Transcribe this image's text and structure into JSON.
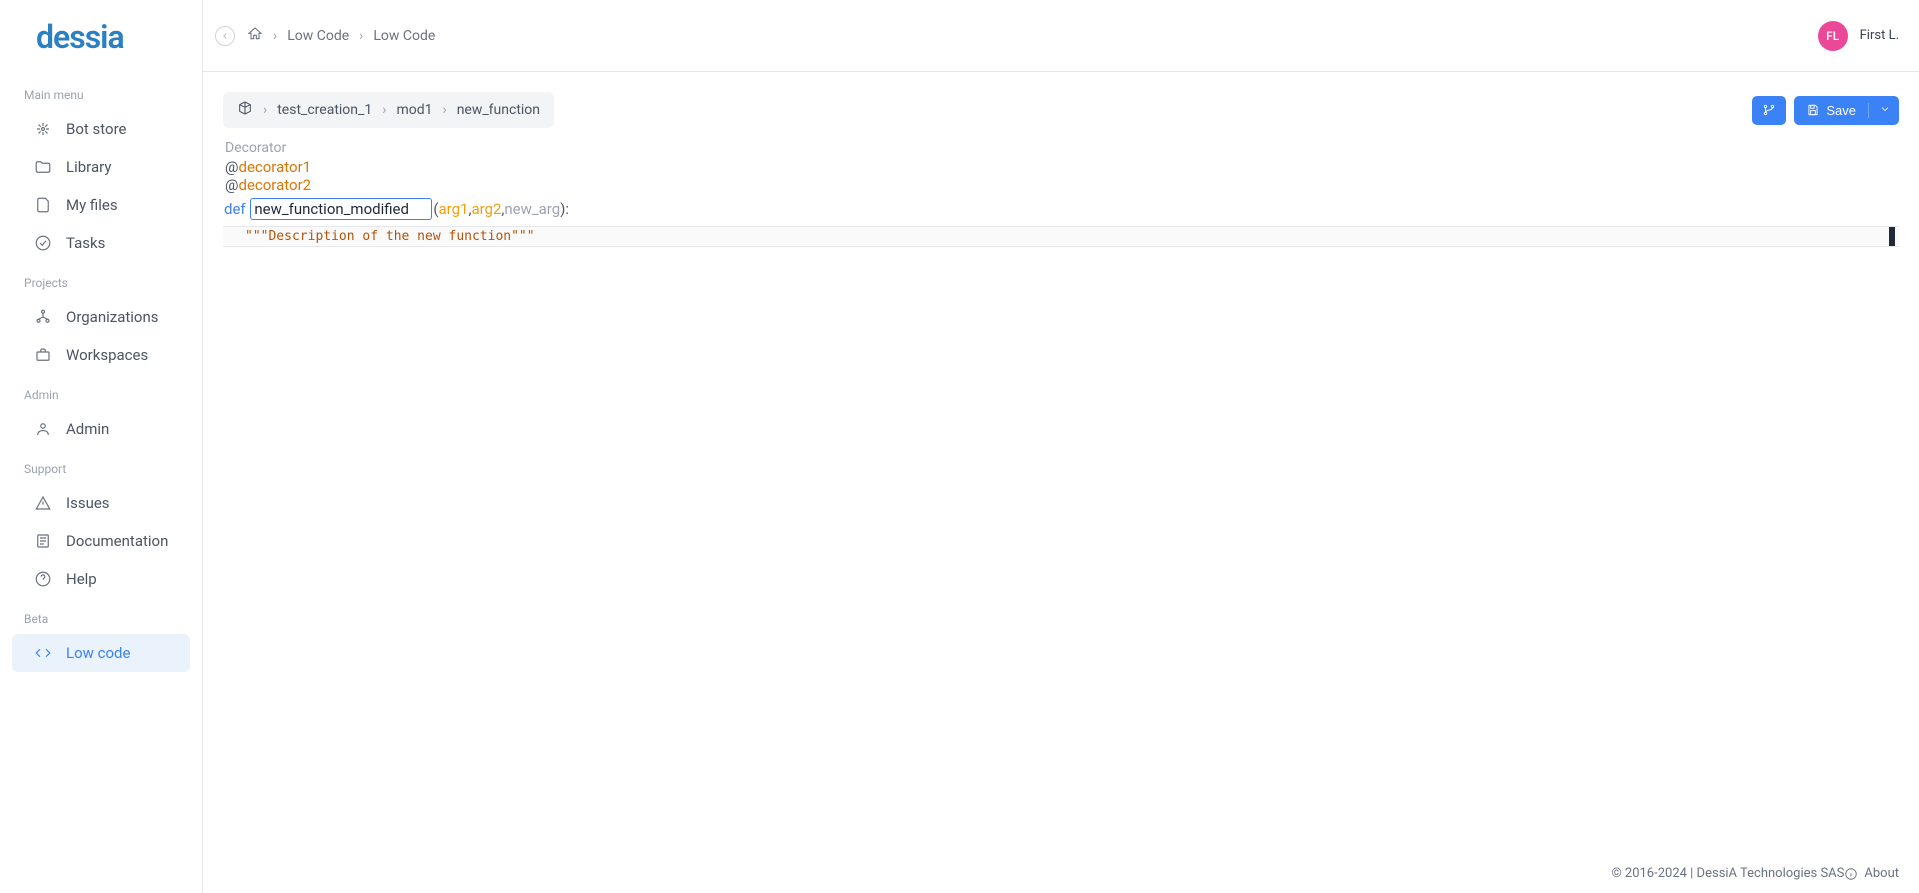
{
  "logo": "dessia",
  "sidebar": {
    "sections": [
      {
        "label": "Main menu",
        "items": [
          {
            "label": "Bot store",
            "icon": "bot-store-icon"
          },
          {
            "label": "Library",
            "icon": "folder-icon"
          },
          {
            "label": "My files",
            "icon": "file-icon"
          },
          {
            "label": "Tasks",
            "icon": "check-circle-icon"
          }
        ]
      },
      {
        "label": "Projects",
        "items": [
          {
            "label": "Organizations",
            "icon": "org-icon"
          },
          {
            "label": "Workspaces",
            "icon": "briefcase-icon"
          }
        ]
      },
      {
        "label": "Admin",
        "items": [
          {
            "label": "Admin",
            "icon": "admin-icon"
          }
        ]
      },
      {
        "label": "Support",
        "items": [
          {
            "label": "Issues",
            "icon": "warning-icon"
          },
          {
            "label": "Documentation",
            "icon": "doc-icon"
          },
          {
            "label": "Help",
            "icon": "help-icon"
          }
        ]
      },
      {
        "label": "Beta",
        "items": [
          {
            "label": "Low code",
            "icon": "code-icon",
            "active": true
          }
        ]
      }
    ]
  },
  "topbar": {
    "breadcrumb": [
      "Low Code",
      "Low Code"
    ],
    "user": {
      "initials": "FL",
      "name": "First L."
    }
  },
  "content_breadcrumb": [
    "test_creation_1",
    "mod1",
    "new_function"
  ],
  "actions": {
    "save_label": "Save"
  },
  "editor": {
    "decorator_label": "Decorator",
    "decorators": [
      "decorator1",
      "decorator2"
    ],
    "def_keyword": "def",
    "function_name": "new_function_modified",
    "args": [
      {
        "name": "arg1",
        "typed": true
      },
      {
        "name": "arg2",
        "typed": true
      },
      {
        "name": "new_arg",
        "typed": false
      }
    ],
    "docstring": "\"\"\"Description of the new function\"\"\""
  },
  "footer": {
    "copyright": "© 2016-2024 | DessiA Technologies SAS",
    "about": "About"
  }
}
